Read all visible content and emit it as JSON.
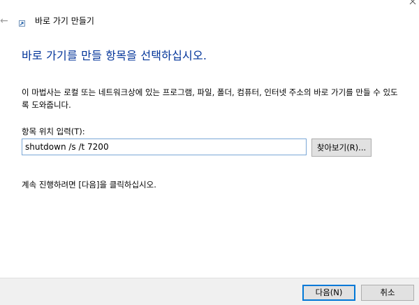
{
  "wizard": {
    "title": "바로 가기 만들기",
    "back_icon": "back-arrow-icon",
    "app_icon": "shortcut-icon"
  },
  "page": {
    "heading": "바로 가기를 만들 항목을 선택하십시오.",
    "description": "이 마법사는 로컬 또는 네트워크상에 있는 프로그램, 파일, 폴더, 컴퓨터, 인터넷 주소의 바로 가기를 만들 수 있도록 도와줍니다.",
    "location_label": "항목 위치 입력(T):",
    "location_value": "shutdown /s /t 7200",
    "browse_label": "찾아보기(R)...",
    "continue_text": "계속 진행하려면 [다음]을 클릭하십시오."
  },
  "footer": {
    "next_label": "다음(N)",
    "cancel_label": "취소"
  },
  "colors": {
    "heading": "#003399",
    "input_border": "#7aa7d6",
    "default_button_border": "#0078d7",
    "footer_bg": "#f0f0f0",
    "button_bg": "#e1e1e1"
  }
}
